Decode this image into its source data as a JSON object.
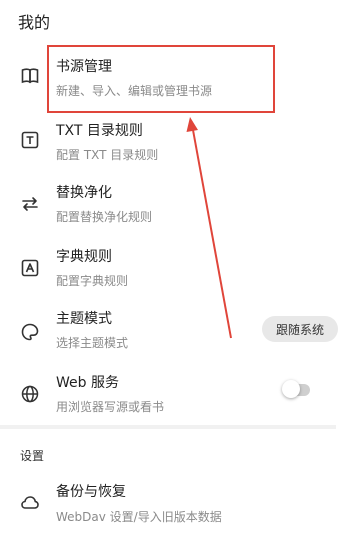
{
  "page": {
    "title": "我的"
  },
  "items": [
    {
      "title": "书源管理",
      "subtitle": "新建、导入、编辑或管理书源",
      "icon": "book-open-icon"
    },
    {
      "title": "TXT 目录规则",
      "subtitle": "配置 TXT 目录规则",
      "icon": "text-t-icon"
    },
    {
      "title": "替换净化",
      "subtitle": "配置替换净化规则",
      "icon": "swap-icon"
    },
    {
      "title": "字典规则",
      "subtitle": "配置字典规则",
      "icon": "dictionary-a-icon"
    },
    {
      "title": "主题模式",
      "subtitle": "选择主题模式",
      "icon": "theme-icon",
      "value": "跟随系统"
    },
    {
      "title": "Web 服务",
      "subtitle": "用浏览器写源或看书",
      "icon": "globe-icon",
      "toggle": false
    }
  ],
  "settings": {
    "label": "设置",
    "items": [
      {
        "title": "备份与恢复",
        "subtitle": "WebDav 设置/导入旧版本数据",
        "icon": "cloud-icon"
      }
    ]
  },
  "annotation": {
    "color": "#e0453a"
  }
}
